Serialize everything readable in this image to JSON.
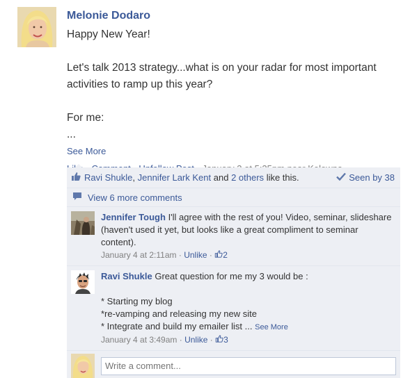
{
  "post": {
    "author": "Melonie Dodaro",
    "text": "Happy New Year!\n\nLet's talk 2013 strategy...what is on your radar for most important activities to ramp up this year?\n\nFor me:\n...",
    "see_more": "See More",
    "actions": {
      "like": "Like",
      "comment": "Comment",
      "unfollow": "Unfollow Post",
      "timestamp": "January 3 at 5:25pm near Kelowna"
    }
  },
  "likes": {
    "user1": "Ravi Shukle",
    "user2": "Jennifer Lark Kent",
    "and_text": "and",
    "others": "2 others",
    "suffix": "like this.",
    "seen": "Seen by 38"
  },
  "view_more": "View 6 more comments",
  "comments": [
    {
      "author": "Jennifer Tough",
      "text": "I'll agree with the rest of you! Video, seminar, slideshare (haven't used it yet, but looks like a great compliment to seminar content).",
      "time": "January 4 at 2:11am",
      "unlike": "Unlike",
      "likes": "2"
    },
    {
      "author": "Ravi Shukle",
      "text": "Great question for me my 3 would be :\n\n* Starting my blog\n*re-vamping and releasing my new site\n* Integrate and build my emailer list ...",
      "see_more": "See More",
      "time": "January 4 at 3:49am",
      "unlike": "Unlike",
      "likes": "3"
    }
  ],
  "composer": {
    "placeholder": "Write a comment..."
  },
  "colors": {
    "link": "#3b5998",
    "ufi_background": "#edeff4",
    "meta_text": "#808080"
  },
  "icons": [
    "thumbs-up-icon",
    "checkmark-icon",
    "comment-bubble-icon"
  ]
}
